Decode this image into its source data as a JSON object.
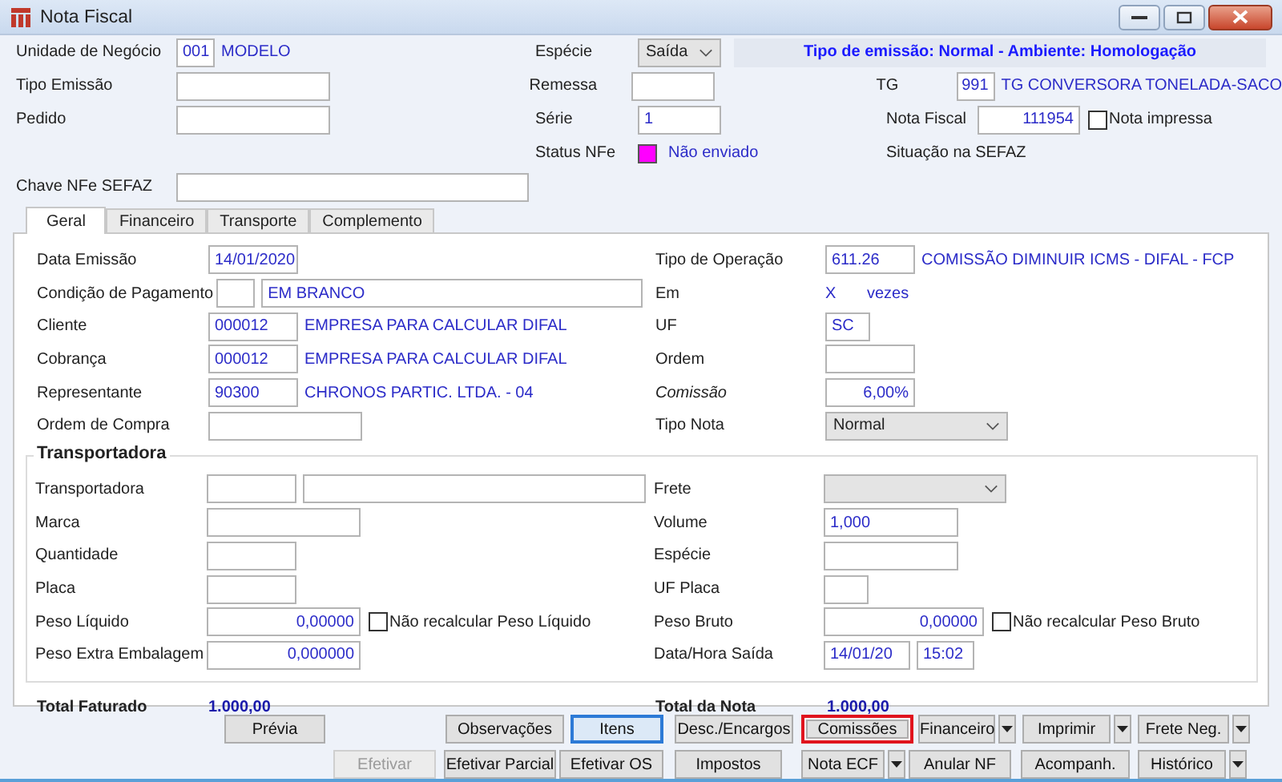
{
  "window": {
    "title": "Nota Fiscal"
  },
  "header": {
    "unidade": {
      "label": "Unidade de Negócio",
      "code": "001",
      "name": "MODELO"
    },
    "especie": {
      "label": "Espécie",
      "value": "Saída"
    },
    "banner": "Tipo de emissão: Normal - Ambiente: Homologação",
    "tipo_emissao": {
      "label": "Tipo Emissão"
    },
    "remessa": {
      "label": "Remessa"
    },
    "tg": {
      "label": "TG",
      "code": "991",
      "name": "TG CONVERSORA TONELADA-SACO"
    },
    "pedido": {
      "label": "Pedido"
    },
    "serie": {
      "label": "Série",
      "value": "1"
    },
    "nota_fiscal": {
      "label": "Nota Fiscal",
      "value": "111954"
    },
    "nota_impressa": {
      "label": "Nota impressa",
      "checked": false
    },
    "status_nfe": {
      "label": "Status NFe",
      "value": "Não enviado",
      "color": "#ff00ff"
    },
    "situacao_sefaz": {
      "label": "Situação na SEFAZ"
    },
    "chave": {
      "label": "Chave NFe SEFAZ"
    }
  },
  "tabs": [
    {
      "label": "Geral",
      "selected": true
    },
    {
      "label": "Financeiro",
      "selected": false
    },
    {
      "label": "Transporte",
      "selected": false
    },
    {
      "label": "Complemento",
      "selected": false
    }
  ],
  "geral": {
    "data_emissao": {
      "label": "Data Emissão",
      "value": "14/01/2020"
    },
    "condicao": {
      "label": "Condição de Pagamento",
      "name": "EM BRANCO"
    },
    "cliente": {
      "label": "Cliente",
      "code": "000012",
      "name": "EMPRESA PARA CALCULAR DIFAL"
    },
    "cobranca": {
      "label": "Cobrança",
      "code": "000012",
      "name": "EMPRESA PARA CALCULAR DIFAL"
    },
    "representante": {
      "label": "Representante",
      "code": "90300",
      "name": "CHRONOS PARTIC. LTDA. - 04"
    },
    "ordem_compra": {
      "label": "Ordem de Compra"
    },
    "tipo_operacao": {
      "label": "Tipo de Operação",
      "code": "611.26",
      "name": "COMISSÃO DIMINUIR ICMS - DIFAL - FCP"
    },
    "em": {
      "label": "Em",
      "value": "X",
      "unit": "vezes"
    },
    "uf": {
      "label": "UF",
      "value": "SC"
    },
    "ordem": {
      "label": "Ordem"
    },
    "comissao": {
      "label": "Comissão",
      "value": "6,00%"
    },
    "tipo_nota": {
      "label": "Tipo Nota",
      "value": "Normal"
    }
  },
  "transporte": {
    "title": "Transportadora",
    "transportadora": {
      "label": "Transportadora"
    },
    "frete": {
      "label": "Frete"
    },
    "marca": {
      "label": "Marca"
    },
    "volume": {
      "label": "Volume",
      "value": "1,000"
    },
    "quantidade": {
      "label": "Quantidade"
    },
    "especie": {
      "label": "Espécie"
    },
    "placa": {
      "label": "Placa"
    },
    "uf_placa": {
      "label": "UF Placa"
    },
    "peso_liquido": {
      "label": "Peso Líquido",
      "value": "0,00000"
    },
    "nao_recalc_liquido": {
      "label": "Não recalcular Peso Líquido",
      "checked": false
    },
    "peso_bruto": {
      "label": "Peso Bruto",
      "value": "0,00000"
    },
    "nao_recalc_bruto": {
      "label": "Não recalcular Peso Bruto",
      "checked": false
    },
    "peso_extra": {
      "label": "Peso Extra Embalagem",
      "value": "0,000000"
    },
    "data_hora_saida": {
      "label": "Data/Hora Saída",
      "date": "14/01/20",
      "time": "15:02"
    }
  },
  "totals": {
    "faturado": {
      "label": "Total Faturado",
      "value": "1.000,00"
    },
    "nota": {
      "label": "Total da Nota",
      "value": "1.000,00"
    }
  },
  "button_rows": [
    {
      "buttons": [
        {
          "label": "Prévia",
          "kind": "button",
          "disabled": false,
          "focused": false,
          "highlighted": false
        },
        {
          "label": "Observações",
          "kind": "button",
          "disabled": false,
          "focused": false,
          "highlighted": false
        },
        {
          "label": "Itens",
          "kind": "button",
          "disabled": false,
          "focused": true,
          "highlighted": false
        },
        {
          "label": "Desc./Encargos",
          "kind": "button",
          "disabled": false,
          "focused": false,
          "highlighted": false
        },
        {
          "label": "Comissões",
          "kind": "button",
          "disabled": false,
          "focused": false,
          "highlighted": true
        },
        {
          "label": "Financeiro",
          "kind": "split",
          "disabled": false,
          "focused": false,
          "highlighted": false
        },
        {
          "label": "Imprimir",
          "kind": "split",
          "disabled": false,
          "focused": false,
          "highlighted": false
        },
        {
          "label": "Frete Neg.",
          "kind": "split",
          "disabled": false,
          "focused": false,
          "highlighted": false
        }
      ]
    },
    {
      "buttons": [
        {
          "label": "Efetivar",
          "kind": "button",
          "disabled": true,
          "focused": false,
          "highlighted": false
        },
        {
          "label": "Efetivar Parcial",
          "kind": "button",
          "disabled": false,
          "focused": false,
          "highlighted": false
        },
        {
          "label": "Efetivar OS",
          "kind": "button",
          "disabled": false,
          "focused": false,
          "highlighted": false
        },
        {
          "label": "Impostos",
          "kind": "button",
          "disabled": false,
          "focused": false,
          "highlighted": false
        },
        {
          "label": "Nota ECF",
          "kind": "split",
          "disabled": false,
          "focused": false,
          "highlighted": false
        },
        {
          "label": "Anular NF",
          "kind": "button",
          "disabled": false,
          "focused": false,
          "highlighted": false
        },
        {
          "label": "Acompanh.",
          "kind": "button",
          "disabled": false,
          "focused": false,
          "highlighted": false
        },
        {
          "label": "Histórico",
          "kind": "split",
          "disabled": false,
          "focused": false,
          "highlighted": false
        }
      ]
    }
  ]
}
